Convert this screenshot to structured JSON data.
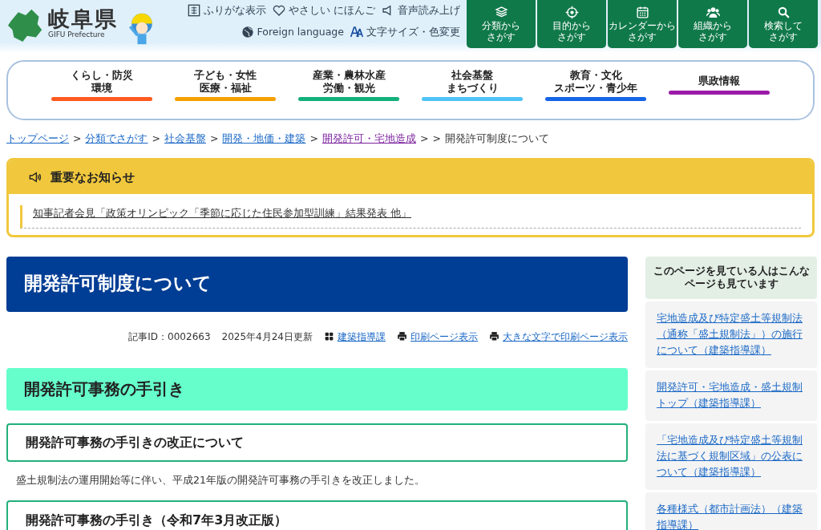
{
  "header": {
    "logo_title": "岐阜県",
    "logo_subtitle": "GIFU Prefecture",
    "utility_links": [
      {
        "kind": "furigana",
        "label": "ふりがな表示"
      },
      {
        "kind": "heart",
        "label": "やさしい にほんご"
      },
      {
        "kind": "speaker",
        "label": "音声読み上げ"
      },
      {
        "kind": "globe",
        "label": "Foreign language"
      },
      {
        "kind": "font",
        "label": "文字サイズ・色変更"
      }
    ],
    "search_buttons": [
      {
        "kind": "book",
        "lines": [
          "分類から",
          "さがす"
        ]
      },
      {
        "kind": "target",
        "lines": [
          "目的から",
          "さがす"
        ]
      },
      {
        "kind": "calendar",
        "lines": [
          "カレンダーから",
          "さがす"
        ]
      },
      {
        "kind": "people",
        "lines": [
          "組織から",
          "さがす"
        ]
      },
      {
        "kind": "search",
        "lines": [
          "検索して",
          "さがす"
        ]
      }
    ]
  },
  "global_nav": [
    {
      "lines": [
        "くらし・防災",
        "環境"
      ],
      "color": "#ff5a1f"
    },
    {
      "lines": [
        "子ども・女性",
        "医療・福祉"
      ],
      "color": "#f5a000"
    },
    {
      "lines": [
        "産業・農林水産",
        "労働・観光"
      ],
      "color": "#12b07a"
    },
    {
      "lines": [
        "社会基盤",
        "まちづくり"
      ],
      "color": "#4fc3f7"
    },
    {
      "lines": [
        "教育・文化",
        "スポーツ・青少年"
      ],
      "color": "#1565e8"
    },
    {
      "lines": [
        "県政情報"
      ],
      "color": "#9c1aa8"
    }
  ],
  "breadcrumb": [
    {
      "kind": "link",
      "label": "トップページ",
      "visited": false
    },
    {
      "kind": "sep",
      "label": ">"
    },
    {
      "kind": "link",
      "label": "分類でさがす",
      "visited": false
    },
    {
      "kind": "sep",
      "label": ">"
    },
    {
      "kind": "link",
      "label": "社会基盤",
      "visited": false
    },
    {
      "kind": "sep",
      "label": ">"
    },
    {
      "kind": "link",
      "label": "開発・地価・建築",
      "visited": false
    },
    {
      "kind": "sep",
      "label": ">"
    },
    {
      "kind": "link",
      "label": "開発許可・宅地造成",
      "visited": true
    },
    {
      "kind": "sep",
      "label": ">"
    },
    {
      "kind": "sep",
      "label": ">"
    },
    {
      "kind": "current",
      "label": "開発許可制度について"
    }
  ],
  "notice": {
    "title": "重要なお知らせ",
    "items": [
      "知事記者会見「政策オリンピック「季節に応じた住民参加型訓練」結果発表 他」"
    ]
  },
  "article": {
    "title": "開発許可制度について",
    "article_id": "記事ID：0002663",
    "updated": "2025年4月24日更新",
    "meta_links": [
      {
        "kind": "dept",
        "label": "建築指導課"
      },
      {
        "kind": "print",
        "label": "印刷ページ表示"
      },
      {
        "kind": "print",
        "label": "大きな文字で印刷ページ表示"
      }
    ],
    "blocks": [
      {
        "kind": "h2",
        "text": "開発許可事務の手引き"
      },
      {
        "kind": "h3",
        "text": "開発許可事務の手引きの改正について"
      },
      {
        "kind": "p",
        "text": "盛土規制法の運用開始等に伴い、平成21年版の開発許可事務の手引きを改正しました。"
      },
      {
        "kind": "h3",
        "text": "開発許可事務の手引き（令和7年3月改正版）"
      }
    ]
  },
  "sidebar": {
    "title": "このページを見ている人はこんなページも見ています",
    "links": [
      "宅地造成及び特定盛土等規制法（通称「盛土規制法」）の施行について（建築指導課）",
      "開発許可・宅地造成・盛土規制トップ（建築指導課）",
      "「宅地造成及び特定盛土等規制法に基づく規制区域」の公表について（建築指導課）",
      "各種様式（都市計画法）（建築指導課）"
    ]
  }
}
